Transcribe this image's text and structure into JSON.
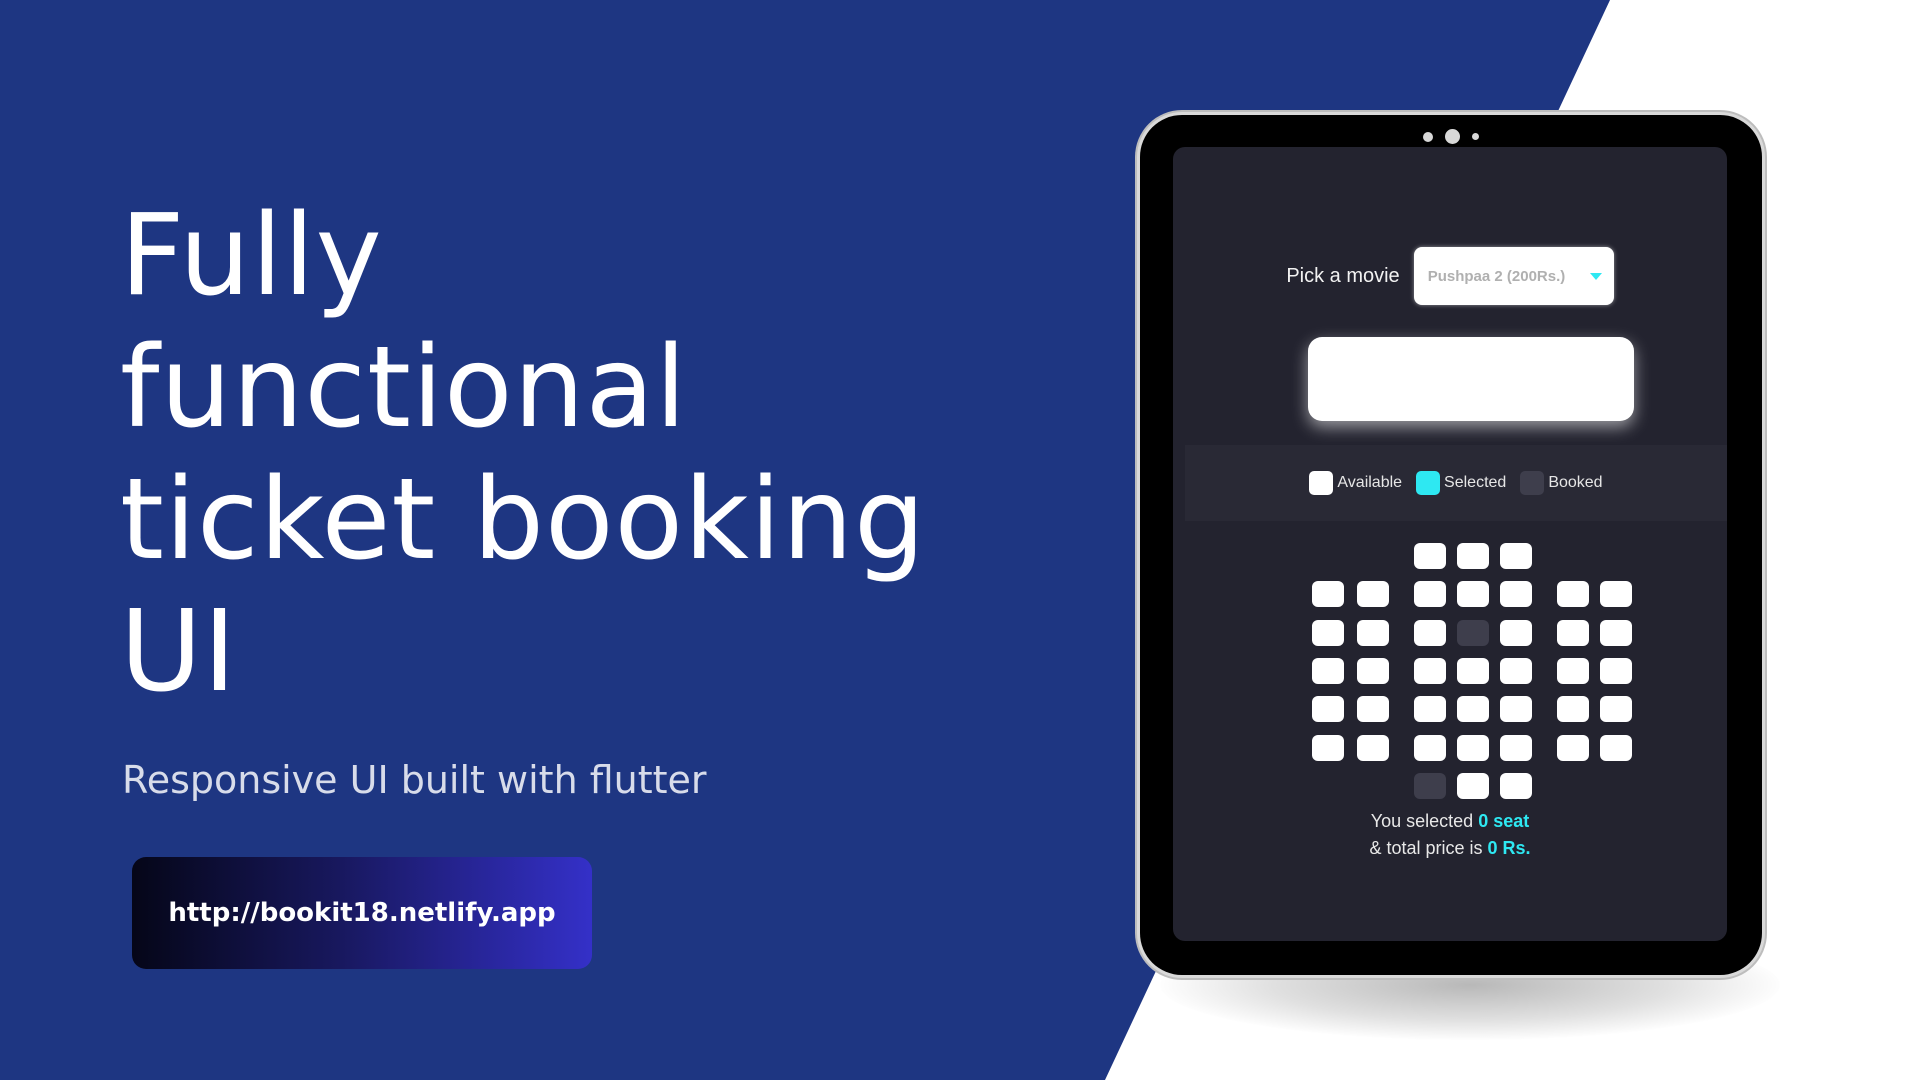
{
  "hero": {
    "headline_lines": [
      "Fully",
      "functional",
      "ticket booking",
      "UI"
    ],
    "subtitle": "Responsive UI built with flutter",
    "url_button_label": "http://bookit18.netlify.app"
  },
  "colors": {
    "background_blue": "#1e3682",
    "accent_cyan": "#2ee8f2",
    "screen_bg": "#23232f",
    "booked_seat": "#3e3e4c"
  },
  "app": {
    "movie_picker": {
      "label": "Pick a movie",
      "selected_value": "Pushpaa 2 (200Rs.)",
      "icon": "chevron-down-icon"
    },
    "legend": {
      "available": "Available",
      "selected": "Selected",
      "booked": "Booked"
    },
    "seats": {
      "rows": [
        {
          "left": "----",
          "middle": "AAA",
          "right": "--"
        },
        {
          "left": "AA",
          "middle": "AAA",
          "right": "AA"
        },
        {
          "left": "AA",
          "middle": "ABA",
          "right": "AA"
        },
        {
          "left": "AA",
          "middle": "AAA",
          "right": "AA"
        },
        {
          "left": "AA",
          "middle": "AAA",
          "right": "AA"
        },
        {
          "left": "AA",
          "middle": "AAA",
          "right": "AA"
        },
        {
          "left": "--",
          "middle": "BAA",
          "right": "--"
        }
      ],
      "legend_codes": {
        "A": "available",
        "B": "booked",
        "-": "none"
      }
    },
    "summary": {
      "line1_prefix": "You selected",
      "seat_count": "0 seat",
      "line2_prefix": "& total price is",
      "total_price": "0 Rs."
    }
  }
}
